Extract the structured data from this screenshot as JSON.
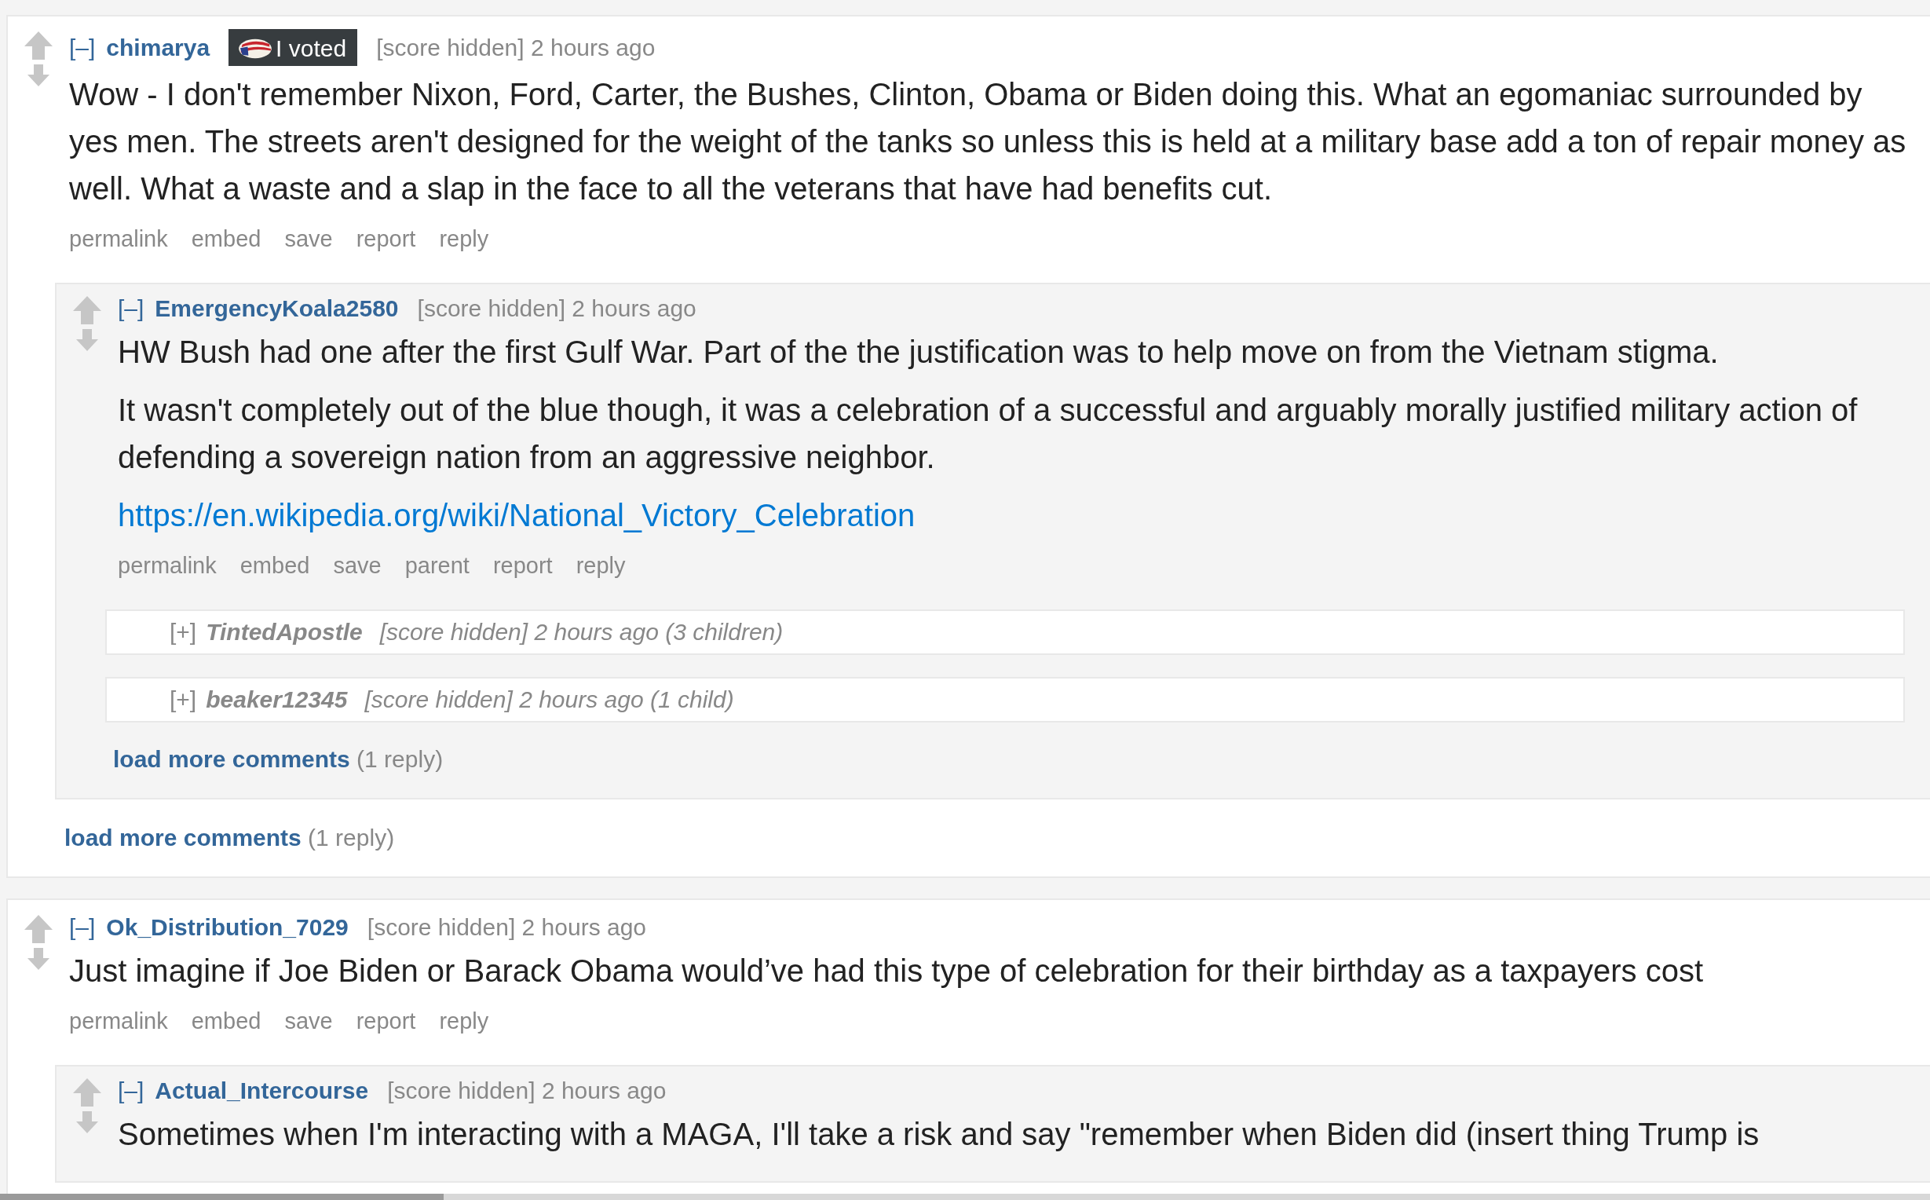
{
  "comments": [
    {
      "kind": "comment",
      "toggle": "[–]",
      "author": "chimarya",
      "flair": {
        "text": "I voted"
      },
      "meta": "[score hidden] 2 hours ago",
      "body": [
        {
          "kind": "text",
          "text": "Wow - I don't remember Nixon, Ford, Carter, the Bushes, Clinton, Obama or Biden doing this. What an egomaniac surrounded by yes men. The streets aren't designed for the weight of the tanks so unless this is held at a military base add a ton of repair money as well. What a waste and a slap in the face to all the veterans that have had benefits cut."
        }
      ],
      "actions": [
        "permalink",
        "embed",
        "save",
        "report",
        "reply"
      ],
      "children": [
        {
          "kind": "comment",
          "toggle": "[–]",
          "author": "EmergencyKoala2580",
          "meta": "[score hidden] 2 hours ago",
          "body": [
            {
              "kind": "text",
              "text": "HW Bush had one after the first Gulf War. Part of the the justification was to help move on from the Vietnam stigma."
            },
            {
              "kind": "text",
              "text": "It wasn't completely out of the blue though, it was a celebration of a successful and arguably morally justified military action of defending a sovereign nation from an aggressive neighbor."
            },
            {
              "kind": "link",
              "text": "https://en.wikipedia.org/wiki/National_Victory_Celebration"
            }
          ],
          "actions": [
            "permalink",
            "embed",
            "save",
            "parent",
            "report",
            "reply"
          ],
          "children": [
            {
              "kind": "collapsed",
              "toggle": "[+]",
              "author": "TintedApostle",
              "meta": "[score hidden] 2 hours ago (3 children)"
            },
            {
              "kind": "collapsed",
              "toggle": "[+]",
              "author": "beaker12345",
              "meta": "[score hidden] 2 hours ago (1 child)"
            }
          ],
          "load_more": {
            "link": "load more comments",
            "count": "(1 reply)"
          }
        }
      ],
      "load_more": {
        "link": "load more comments",
        "count": "(1 reply)"
      }
    },
    {
      "kind": "comment",
      "toggle": "[–]",
      "author": "Ok_Distribution_7029",
      "meta": "[score hidden] 2 hours ago",
      "body": [
        {
          "kind": "text",
          "text": "Just imagine if Joe Biden or Barack Obama would’ve had this type of celebration for their birthday as a taxpayers cost"
        }
      ],
      "actions": [
        "permalink",
        "embed",
        "save",
        "report",
        "reply"
      ],
      "children": [
        {
          "kind": "comment",
          "toggle": "[–]",
          "author": "Actual_Intercourse",
          "meta": "[score hidden] 2 hours ago",
          "body": [
            {
              "kind": "text",
              "text": "Sometimes when I'm interacting with a MAGA, I'll take a risk and say \"remember when Biden did (insert thing Trump is"
            }
          ]
        }
      ]
    }
  ]
}
